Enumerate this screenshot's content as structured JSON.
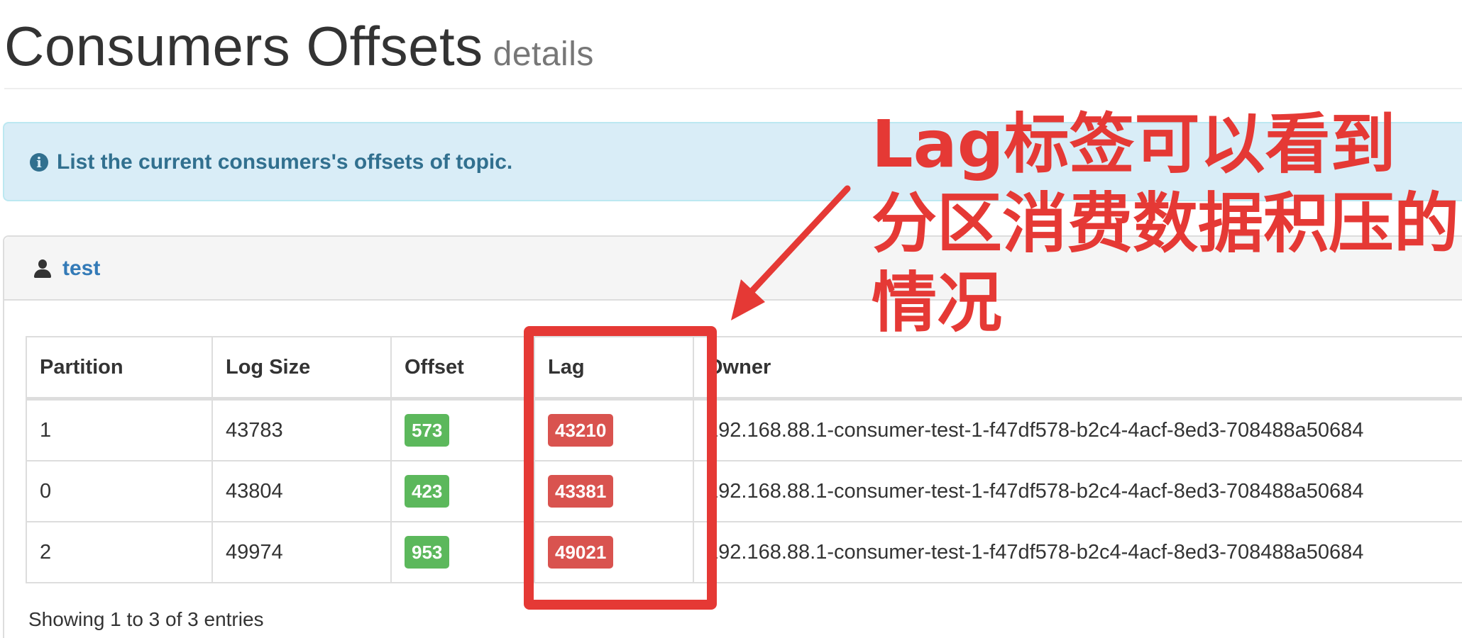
{
  "header": {
    "title": "Consumers Offsets",
    "subtitle": "details"
  },
  "alert": {
    "icon": "info-circle-icon",
    "message": "List the current consumers's offsets of topic."
  },
  "panel": {
    "icon": "user-icon",
    "group_name": "test"
  },
  "table": {
    "columns": [
      "Partition",
      "Log Size",
      "Offset",
      "Lag",
      "Owner"
    ],
    "rows": [
      {
        "partition": "1",
        "log_size": "43783",
        "offset": "573",
        "lag": "43210",
        "owner": "192.168.88.1-consumer-test-1-f47df578-b2c4-4acf-8ed3-708488a50684"
      },
      {
        "partition": "0",
        "log_size": "43804",
        "offset": "423",
        "lag": "43381",
        "owner": "192.168.88.1-consumer-test-1-f47df578-b2c4-4acf-8ed3-708488a50684"
      },
      {
        "partition": "2",
        "log_size": "49974",
        "offset": "953",
        "lag": "49021",
        "owner": "192.168.88.1-consumer-test-1-f47df578-b2c4-4acf-8ed3-708488a50684"
      }
    ],
    "footer": "Showing 1 to 3 of 3 entries"
  },
  "annotation": {
    "lines": [
      "Lag标签可以看到",
      "分区消费数据积压的",
      "情况"
    ],
    "color": "#e53935"
  },
  "colors": {
    "offset_badge": "#5cb85c",
    "lag_badge": "#d9534f",
    "alert_bg": "#d9edf7",
    "alert_text": "#31708f",
    "link": "#337ab7"
  }
}
